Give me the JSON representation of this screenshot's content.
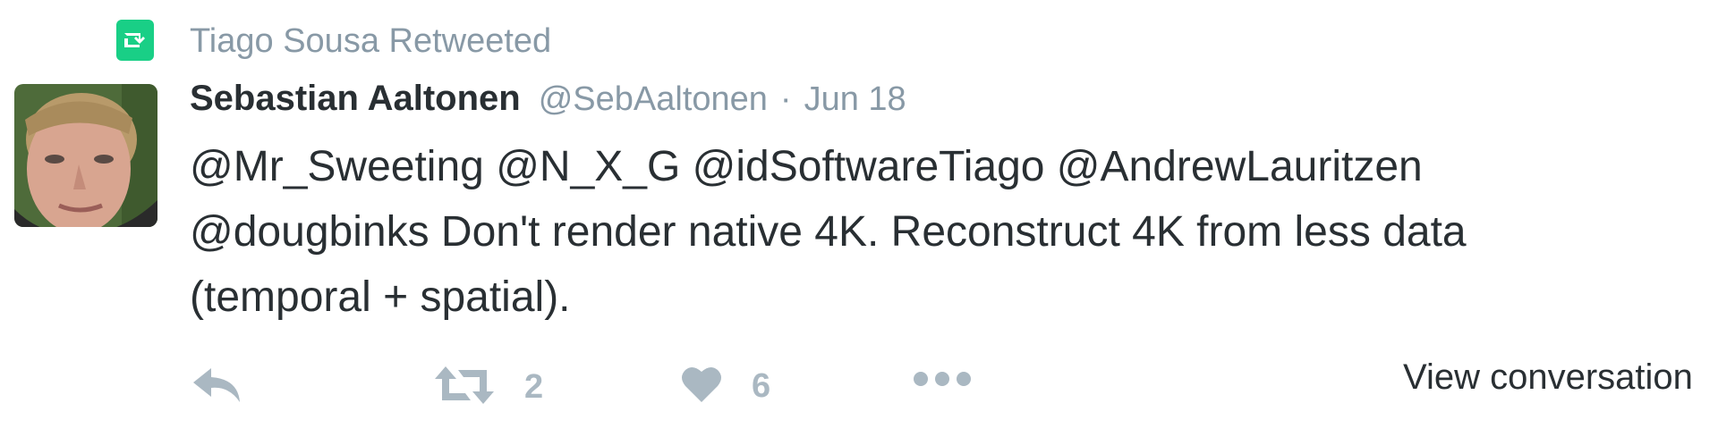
{
  "context": {
    "text": "Tiago Sousa Retweeted",
    "icon": "retweet-icon",
    "icon_color": "#19cf86"
  },
  "author": {
    "fullname": "Sebastian Aaltonen",
    "username": "@SebAaltonen",
    "separator": "·",
    "timestamp": "Jun 18",
    "avatar": "profile-photo"
  },
  "tweet": {
    "lines": [
      "@Mr_Sweeting @N_X_G @idSoftwareTiago @AndrewLauritzen",
      "@dougbinks Don't render native 4K. Reconstruct 4K from less data",
      "(temporal + spatial)."
    ]
  },
  "actions": {
    "reply_icon": "reply-icon",
    "retweet_icon": "retweet-icon",
    "retweet_count": "2",
    "like_icon": "heart-icon",
    "like_count": "6",
    "more_icon": "more-dots-icon",
    "view_conversation": "View conversation"
  },
  "colors": {
    "text": "#292f33",
    "muted": "#8899a6",
    "action": "#aab8c2"
  }
}
